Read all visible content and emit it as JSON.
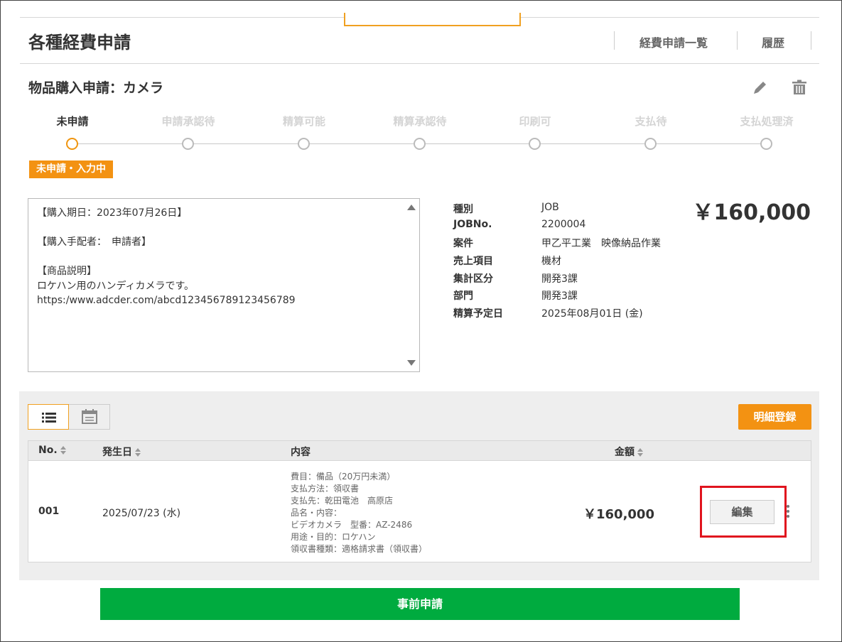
{
  "header": {
    "title": "各種経費申請",
    "nav": [
      {
        "label": "経費申請一覧"
      },
      {
        "label": "履歴"
      }
    ]
  },
  "request": {
    "title": "物品購入申請：カメラ",
    "icons": [
      "pencil-icon",
      "trash-icon"
    ]
  },
  "progress": {
    "steps": [
      {
        "label": "未申請",
        "active": true
      },
      {
        "label": "申請承認待",
        "active": false
      },
      {
        "label": "精算可能",
        "active": false
      },
      {
        "label": "精算承認待",
        "active": false
      },
      {
        "label": "印刷可",
        "active": false
      },
      {
        "label": "支払待",
        "active": false
      },
      {
        "label": "支払処理済",
        "active": false
      }
    ],
    "status_badge": "未申請・入力中",
    "accent_color": "#f39212"
  },
  "memo": {
    "text": "【購入期日：2023年07月26日】\n\n【購入手配者：　申請者】\n\n【商品説明】\nロケハン用のハンディカメラです。\nhttps:/www.adcder.com/abcd123456789123456789"
  },
  "details": [
    {
      "key": "種別",
      "value": "JOB"
    },
    {
      "key": "JOBNo.",
      "value": "2200004"
    },
    {
      "key": "案件",
      "value": "甲乙平工業　映像納品作業"
    },
    {
      "key": "売上項目",
      "value": "機材"
    },
    {
      "key": "集計区分",
      "value": "開発3課"
    },
    {
      "key": "部門",
      "value": "開発3課"
    },
    {
      "key": "精算予定日",
      "value": "2025年08月01日 (金)"
    }
  ],
  "total": "￥160,000",
  "items": {
    "register_label": "明細登録",
    "view_icons": [
      "list-icon",
      "calendar-icon"
    ],
    "columns": {
      "no": "No.",
      "date": "発生日",
      "content": "内容",
      "amount": "金額"
    },
    "rows": [
      {
        "no": "001",
        "date": "2025/07/23 (水)",
        "content": "費目：備品（20万円未満）\n支払方法：領収書\n支払先：乾田電池　高原店\n品名・内容：\nビデオカメラ　型番：AZ-2486\n用途・目的：ロケハン\n領収書種類：適格請求書（領収書）",
        "amount": "￥160,000",
        "edit_label": "編集"
      }
    ]
  },
  "submit_label": "事前申請",
  "colors": {
    "orange": "#f39212",
    "green": "#00ab3f",
    "highlight": "#e0141e"
  }
}
